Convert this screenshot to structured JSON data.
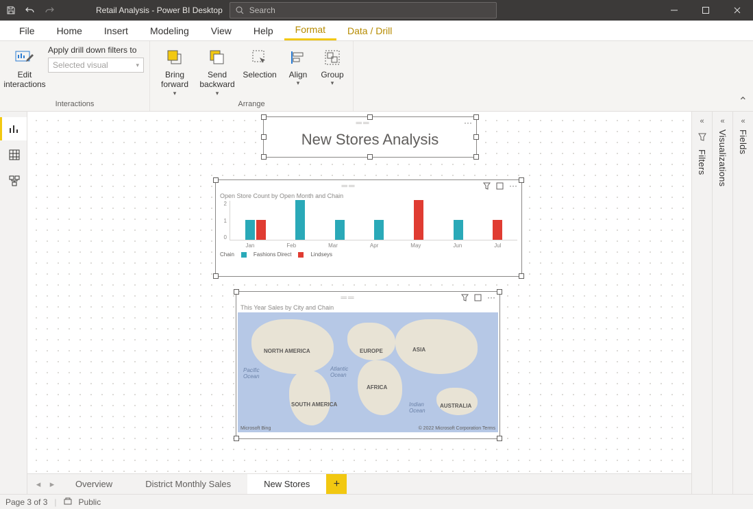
{
  "titlebar": {
    "app_title": "Retail Analysis - Power BI Desktop",
    "search_placeholder": "Search"
  },
  "menu": {
    "tabs": [
      "File",
      "Home",
      "Insert",
      "Modeling",
      "View",
      "Help",
      "Format",
      "Data / Drill"
    ],
    "active": "Format"
  },
  "ribbon": {
    "interactions": {
      "edit": "Edit\ninteractions",
      "apply_label": "Apply drill down filters to",
      "apply_value": "Selected visual",
      "group_label": "Interactions"
    },
    "arrange": {
      "bring": "Bring\nforward",
      "send": "Send\nbackward",
      "selection": "Selection",
      "align": "Align",
      "group": "Group",
      "group_label": "Arrange"
    }
  },
  "canvas": {
    "title_visual": "New Stores Analysis",
    "bar_visual": {
      "title": "Open Store Count by Open Month and Chain",
      "legend_label": "Chain",
      "series1": "Fashions Direct",
      "series2": "Lindseys"
    },
    "map_visual": {
      "title": "This Year Sales by City and Chain",
      "labels": {
        "na": "NORTH AMERICA",
        "sa": "SOUTH AMERICA",
        "eu": "EUROPE",
        "af": "AFRICA",
        "as": "ASIA",
        "au": "AUSTRALIA",
        "pacific": "Pacific\nOcean",
        "atlantic": "Atlantic\nOcean",
        "indian": "Indian\nOcean"
      },
      "attr_left": "Microsoft Bing",
      "attr_right": "© 2022 Microsoft Corporation  Terms"
    }
  },
  "chart_data": {
    "type": "bar",
    "title": "Open Store Count by Open Month and Chain",
    "xlabel": "Open Month",
    "ylabel": "Open Store Count",
    "ylim": [
      0,
      2
    ],
    "categories": [
      "Jan",
      "Feb",
      "Mar",
      "Apr",
      "May",
      "Jun",
      "Jul"
    ],
    "series": [
      {
        "name": "Fashions Direct",
        "color": "#2aa9b8",
        "values": [
          1,
          2,
          1,
          1,
          0,
          1,
          0
        ]
      },
      {
        "name": "Lindseys",
        "color": "#e03c32",
        "values": [
          1,
          0,
          0,
          0,
          2,
          0,
          1
        ]
      }
    ]
  },
  "page_tabs": [
    "Overview",
    "District Monthly Sales",
    "New Stores"
  ],
  "page_tabs_active": 2,
  "statusbar": {
    "page": "Page 3 of 3",
    "sensitivity": "Public"
  },
  "panes": {
    "filters": "Filters",
    "viz": "Visualizations",
    "fields": "Fields"
  }
}
